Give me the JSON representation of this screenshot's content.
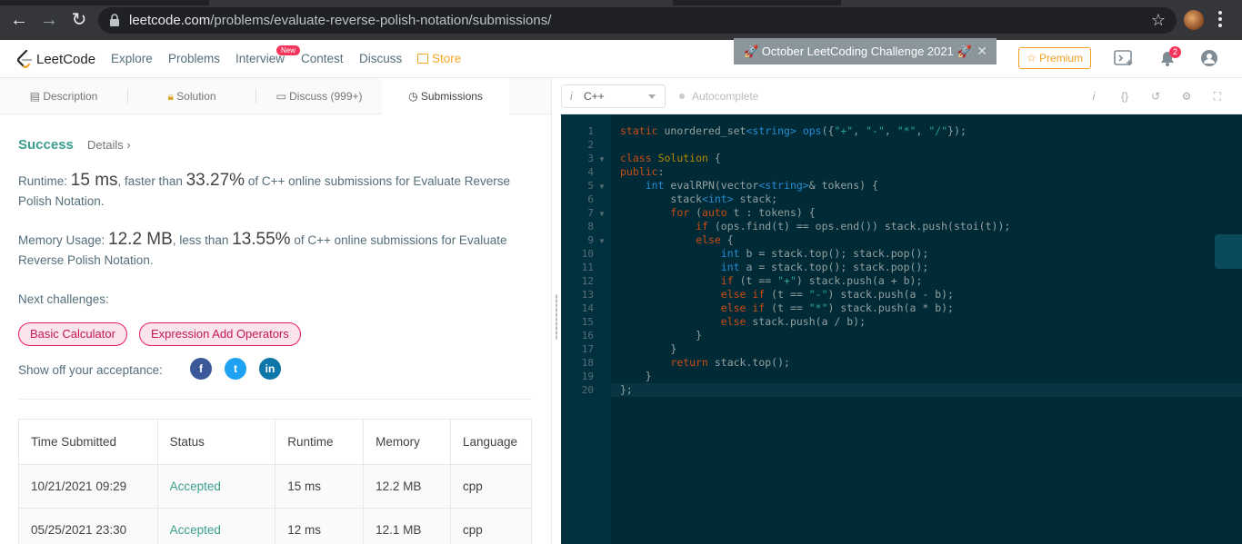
{
  "browser": {
    "url_host": "leetcode.com",
    "url_path": "/problems/evaluate-reverse-polish-notation/submissions/"
  },
  "nav": {
    "logo": "LeetCode",
    "links": [
      "Explore",
      "Problems",
      "Interview",
      "Contest",
      "Discuss",
      "Store"
    ],
    "new_badge": "New",
    "banner": "🚀 October LeetCoding Challenge 2021 🚀",
    "premium": "☆ Premium",
    "notifications": "2"
  },
  "tabs": {
    "description": "Description",
    "solution": "Solution",
    "discuss": "Discuss (999+)",
    "submissions": "Submissions"
  },
  "result": {
    "status": "Success",
    "details": "Details ›",
    "runtime_label": "Runtime:",
    "runtime_value": "15 ms",
    "runtime_mid": ", faster than",
    "runtime_pct": "33.27%",
    "runtime_tail": "of C++ online submissions for Evaluate Reverse Polish Notation.",
    "memory_label": "Memory Usage:",
    "memory_value": "12.2 MB",
    "memory_mid": ", less than",
    "memory_pct": "13.55%",
    "memory_tail": "of C++ online submissions for Evaluate Reverse Polish Notation.",
    "next_label": "Next challenges:",
    "challenges": [
      "Basic Calculator",
      "Expression Add Operators"
    ],
    "show_off": "Show off your acceptance:"
  },
  "table": {
    "headers": [
      "Time Submitted",
      "Status",
      "Runtime",
      "Memory",
      "Language"
    ],
    "rows": [
      [
        "10/21/2021 09:29",
        "Accepted",
        "15 ms",
        "12.2 MB",
        "cpp"
      ],
      [
        "05/25/2021 23:30",
        "Accepted",
        "12 ms",
        "12.1 MB",
        "cpp"
      ]
    ]
  },
  "editor": {
    "language": "C++",
    "autocomplete": "Autocomplete",
    "line_numbers": [
      "1",
      "2",
      "3",
      "4",
      "5",
      "6",
      "7",
      "8",
      "9",
      "10",
      "11",
      "12",
      "13",
      "14",
      "15",
      "16",
      "17",
      "18",
      "19",
      "20"
    ]
  },
  "colors": {
    "accent_green": "#3c9f8b",
    "editor_bg": "#002b36",
    "chip_pink": "#e91e63",
    "store_orange": "#f5a623"
  }
}
